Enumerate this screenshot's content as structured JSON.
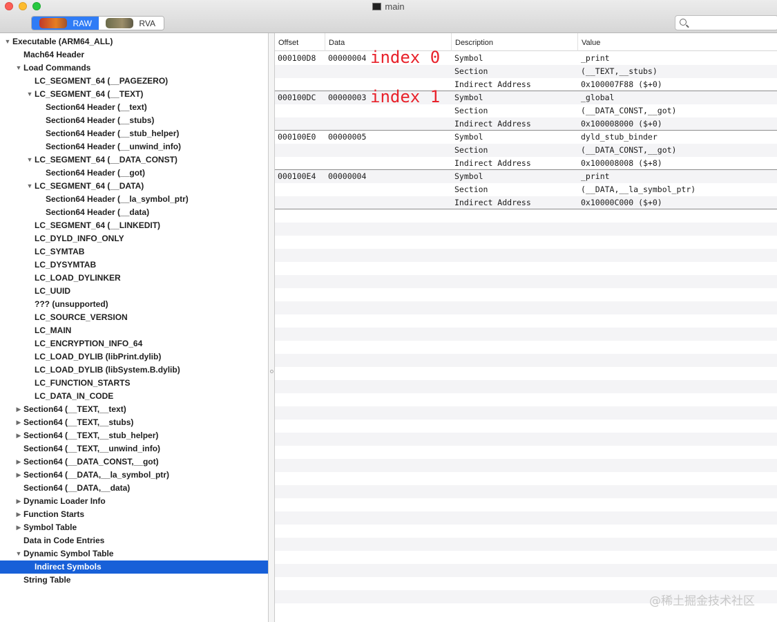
{
  "window": {
    "title": "main"
  },
  "toolbar": {
    "raw_label": "RAW",
    "rva_label": "RVA",
    "search_placeholder": ""
  },
  "sidebar": {
    "items": [
      {
        "label": "Executable  (ARM64_ALL)",
        "level": 0,
        "disclosure": "open"
      },
      {
        "label": "Mach64 Header",
        "level": 1,
        "disclosure": "none"
      },
      {
        "label": "Load Commands",
        "level": 1,
        "disclosure": "open"
      },
      {
        "label": "LC_SEGMENT_64 (__PAGEZERO)",
        "level": 2,
        "disclosure": "none"
      },
      {
        "label": "LC_SEGMENT_64 (__TEXT)",
        "level": 2,
        "disclosure": "open"
      },
      {
        "label": "Section64 Header (__text)",
        "level": 3,
        "disclosure": "none"
      },
      {
        "label": "Section64 Header (__stubs)",
        "level": 3,
        "disclosure": "none"
      },
      {
        "label": "Section64 Header (__stub_helper)",
        "level": 3,
        "disclosure": "none"
      },
      {
        "label": "Section64 Header (__unwind_info)",
        "level": 3,
        "disclosure": "none"
      },
      {
        "label": "LC_SEGMENT_64 (__DATA_CONST)",
        "level": 2,
        "disclosure": "open"
      },
      {
        "label": "Section64 Header (__got)",
        "level": 3,
        "disclosure": "none"
      },
      {
        "label": "LC_SEGMENT_64 (__DATA)",
        "level": 2,
        "disclosure": "open"
      },
      {
        "label": "Section64 Header (__la_symbol_ptr)",
        "level": 3,
        "disclosure": "none"
      },
      {
        "label": "Section64 Header (__data)",
        "level": 3,
        "disclosure": "none"
      },
      {
        "label": "LC_SEGMENT_64 (__LINKEDIT)",
        "level": 2,
        "disclosure": "none"
      },
      {
        "label": "LC_DYLD_INFO_ONLY",
        "level": 2,
        "disclosure": "none"
      },
      {
        "label": "LC_SYMTAB",
        "level": 2,
        "disclosure": "none"
      },
      {
        "label": "LC_DYSYMTAB",
        "level": 2,
        "disclosure": "none"
      },
      {
        "label": "LC_LOAD_DYLINKER",
        "level": 2,
        "disclosure": "none"
      },
      {
        "label": "LC_UUID",
        "level": 2,
        "disclosure": "none"
      },
      {
        "label": "??? (unsupported)",
        "level": 2,
        "disclosure": "none"
      },
      {
        "label": "LC_SOURCE_VERSION",
        "level": 2,
        "disclosure": "none"
      },
      {
        "label": "LC_MAIN",
        "level": 2,
        "disclosure": "none"
      },
      {
        "label": "LC_ENCRYPTION_INFO_64",
        "level": 2,
        "disclosure": "none"
      },
      {
        "label": "LC_LOAD_DYLIB (libPrint.dylib)",
        "level": 2,
        "disclosure": "none"
      },
      {
        "label": "LC_LOAD_DYLIB (libSystem.B.dylib)",
        "level": 2,
        "disclosure": "none"
      },
      {
        "label": "LC_FUNCTION_STARTS",
        "level": 2,
        "disclosure": "none"
      },
      {
        "label": "LC_DATA_IN_CODE",
        "level": 2,
        "disclosure": "none"
      },
      {
        "label": "Section64 (__TEXT,__text)",
        "level": 1,
        "disclosure": "closed"
      },
      {
        "label": "Section64 (__TEXT,__stubs)",
        "level": 1,
        "disclosure": "closed"
      },
      {
        "label": "Section64 (__TEXT,__stub_helper)",
        "level": 1,
        "disclosure": "closed"
      },
      {
        "label": "Section64 (__TEXT,__unwind_info)",
        "level": 1,
        "disclosure": "none"
      },
      {
        "label": "Section64 (__DATA_CONST,__got)",
        "level": 1,
        "disclosure": "closed"
      },
      {
        "label": "Section64 (__DATA,__la_symbol_ptr)",
        "level": 1,
        "disclosure": "closed"
      },
      {
        "label": "Section64 (__DATA,__data)",
        "level": 1,
        "disclosure": "none"
      },
      {
        "label": "Dynamic Loader Info",
        "level": 1,
        "disclosure": "closed"
      },
      {
        "label": "Function Starts",
        "level": 1,
        "disclosure": "closed"
      },
      {
        "label": "Symbol Table",
        "level": 1,
        "disclosure": "closed"
      },
      {
        "label": "Data in Code Entries",
        "level": 1,
        "disclosure": "none"
      },
      {
        "label": "Dynamic Symbol Table",
        "level": 1,
        "disclosure": "open"
      },
      {
        "label": "Indirect Symbols",
        "level": 2,
        "disclosure": "none",
        "selected": true
      },
      {
        "label": "String Table",
        "level": 1,
        "disclosure": "none"
      }
    ]
  },
  "table": {
    "columns": [
      "Offset",
      "Data",
      "Description",
      "Value"
    ],
    "groups": [
      {
        "offset": "000100D8",
        "data": "00000004",
        "annotation": "index 0",
        "rows": [
          {
            "description": "Symbol",
            "value": "_print"
          },
          {
            "description": "Section",
            "value": "(__TEXT,__stubs)"
          },
          {
            "description": "Indirect Address",
            "value": "0x100007F88 ($+0)"
          }
        ]
      },
      {
        "offset": "000100DC",
        "data": "00000003",
        "annotation": "index 1",
        "rows": [
          {
            "description": "Symbol",
            "value": "_global"
          },
          {
            "description": "Section",
            "value": "(__DATA_CONST,__got)"
          },
          {
            "description": "Indirect Address",
            "value": "0x100008000 ($+0)"
          }
        ]
      },
      {
        "offset": "000100E0",
        "data": "00000005",
        "annotation": "",
        "rows": [
          {
            "description": "Symbol",
            "value": "dyld_stub_binder"
          },
          {
            "description": "Section",
            "value": "(__DATA_CONST,__got)"
          },
          {
            "description": "Indirect Address",
            "value": "0x100008008 ($+8)"
          }
        ]
      },
      {
        "offset": "000100E4",
        "data": "00000004",
        "annotation": "",
        "rows": [
          {
            "description": "Symbol",
            "value": "_print"
          },
          {
            "description": "Section",
            "value": "(__DATA,__la_symbol_ptr)"
          },
          {
            "description": "Indirect Address",
            "value": "0x10000C000 ($+0)"
          }
        ]
      }
    ]
  },
  "watermark": "@稀土掘金技术社区"
}
